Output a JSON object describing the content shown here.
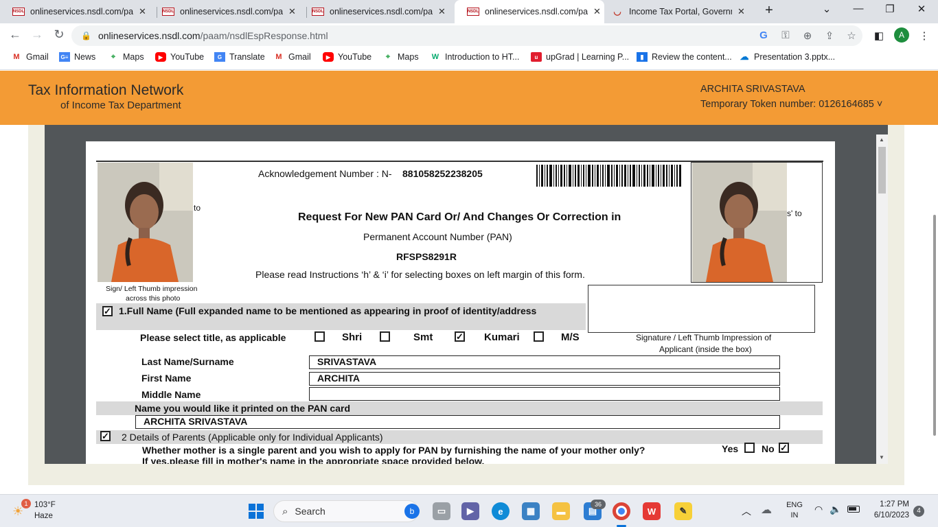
{
  "browser": {
    "tabs": [
      {
        "title": "onlineservices.nsdl.com/paam",
        "favicon": "nsdl-icon",
        "active": false
      },
      {
        "title": "onlineservices.nsdl.com/paam",
        "favicon": "nsdl-icon",
        "active": false
      },
      {
        "title": "onlineservices.nsdl.com/paam",
        "favicon": "nsdl-icon",
        "active": false
      },
      {
        "title": "onlineservices.nsdl.com/paam",
        "favicon": "nsdl-icon",
        "active": true
      },
      {
        "title": "Income Tax Portal, Government",
        "favicon": "income-tax-icon",
        "active": false
      }
    ],
    "url_host": "onlineservices.nsdl.com",
    "url_path": "/paam/nsdlEspResponse.html",
    "profile_initial": "A",
    "favicon_text": "NSDL",
    "bookmarks": [
      {
        "label": "Gmail",
        "icon": "gmail-icon"
      },
      {
        "label": "News",
        "icon": "news-icon"
      },
      {
        "label": "Maps",
        "icon": "maps-icon"
      },
      {
        "label": "YouTube",
        "icon": "youtube-icon"
      },
      {
        "label": "Translate",
        "icon": "translate-icon"
      },
      {
        "label": "Gmail",
        "icon": "gmail-icon"
      },
      {
        "label": "YouTube",
        "icon": "youtube-icon"
      },
      {
        "label": "Maps",
        "icon": "maps-icon"
      },
      {
        "label": "Introduction to HT...",
        "icon": "w3-icon"
      },
      {
        "label": "upGrad | Learning P...",
        "icon": "upgrad-icon"
      },
      {
        "label": "Review the content...",
        "icon": "page-icon"
      },
      {
        "label": "Presentation 3.pptx...",
        "icon": "onedrive-icon"
      }
    ]
  },
  "header": {
    "title_line1": "Tax Information Network",
    "title_line2": "of Income Tax Department",
    "user_name": "ARCHITA SRIVASTAVA",
    "token_text": "Temporary Token number: 0126164685 ˅"
  },
  "form": {
    "ack_label": "Acknowledgement Number : N-",
    "ack_number": "881058252238205",
    "title": "Request For New PAN Card Or/ And Changes Or Correction in",
    "subtitle": "Permanent Account Number (PAN)",
    "pan": "RFSPS8291R",
    "instruction": "Please read Instructions ‘h’ & ‘i’ for selecting boxes on left margin of this form.",
    "left_photo_side_text": "to",
    "right_photo_side_text": "s' to",
    "sign_caption_1": "Sign/ Left Thumb impression",
    "sign_caption_2": "across this photo",
    "section1_title": "1.Full Name (Full expanded name to be mentioned as appearing in proof of identity/address",
    "title_prompt": "Please select title, as applicable",
    "title_options": [
      "Shri",
      "Smt",
      "Kumari",
      "M/S"
    ],
    "selected_title": "Kumari",
    "signature_caption_1": "Signature / Left Thumb Impression of",
    "signature_caption_2": "Applicant (inside the box)",
    "last_name_label": "Last  Name/Surname",
    "last_name_value": "SRIVASTAVA",
    "first_name_label": "First Name",
    "first_name_value": "ARCHITA",
    "middle_name_label": "Middle Name",
    "middle_name_value": "",
    "print_name_label": "Name you would like it printed on the PAN card",
    "print_name_value": "ARCHITA SRIVASTAVA",
    "section2_title": "2 Details of Parents (Applicable only for Individual Applicants)",
    "single_parent_question": "Whether mother is a single parent and you wish to apply for PAN by furnishing the name of your mother only?",
    "yes_label": "Yes",
    "no_label": "No",
    "single_parent_answer": "No",
    "if_yes_text": "If yes,please fill in mother's name in the appropriate space provided below."
  },
  "taskbar": {
    "weather_temp": "103°F",
    "weather_desc": "Haze",
    "weather_badge": "1",
    "search_label": "Search",
    "store_badge": "36",
    "lang_1": "ENG",
    "lang_2": "IN",
    "time": "1:27 PM",
    "date": "6/10/2023",
    "notification_count": "4"
  }
}
